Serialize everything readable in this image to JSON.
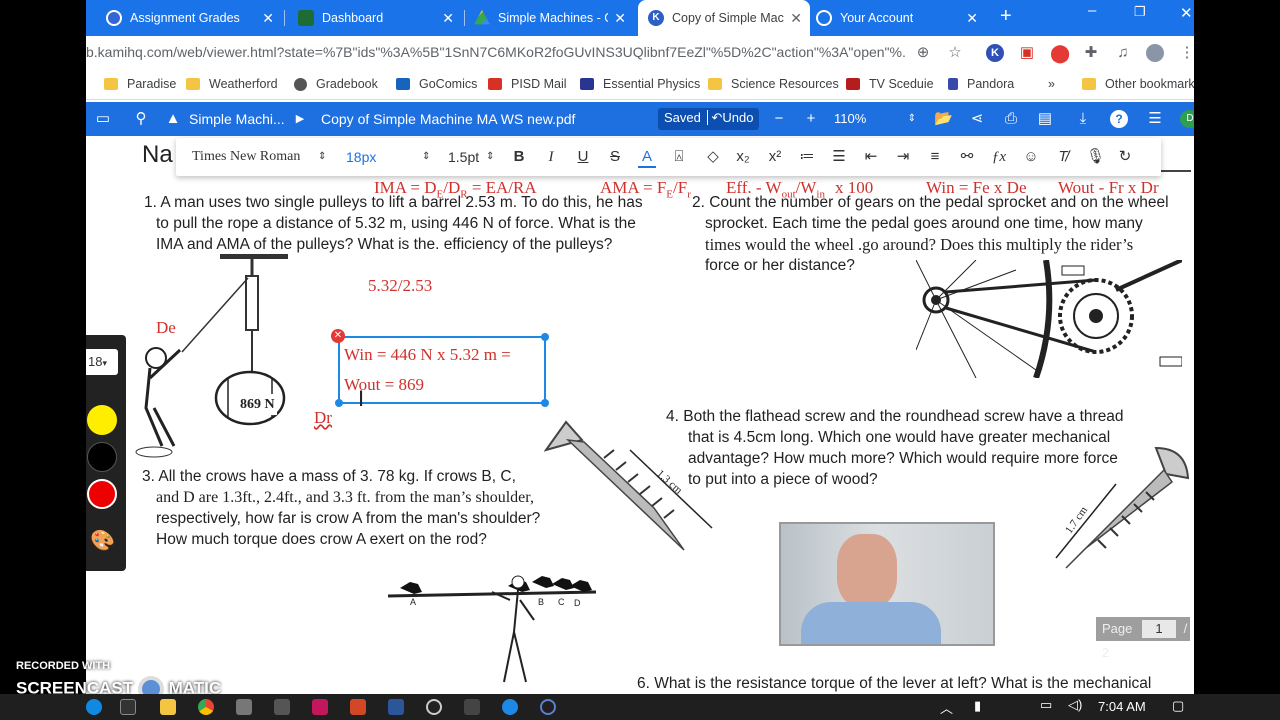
{
  "tabs": [
    {
      "title": "Assignment Grades",
      "active": false
    },
    {
      "title": "Dashboard",
      "active": false
    },
    {
      "title": "Simple Machines - G",
      "active": false
    },
    {
      "title": "Copy of Simple Mac",
      "active": true
    },
    {
      "title": "Your Account",
      "active": false
    }
  ],
  "address": {
    "url": "b.kamihq.com/web/viewer.html?state=%7B\"ids\"%3A%5B\"1SnN7C6MKoR2foGUvINS3UQlibnf7EeZl\"%5D%2C\"action\"%3A\"open\"%..."
  },
  "bookmarks": [
    "Paradise",
    "Weatherford",
    "Gradebook",
    "GoComics",
    "PISD Mail",
    "Essential Physics",
    "Science Resources",
    "TV Sceduie",
    "Pandora",
    "Other bookmarks"
  ],
  "kami": {
    "breadcrumb_folder": "Simple Machi...",
    "filename": "Copy of Simple Machine MA WS new.pdf",
    "saved": "Saved",
    "undo": "Undo",
    "zoom": "110%"
  },
  "format": {
    "font": "Times New Roman",
    "size": "18px",
    "line": "1.5pt"
  },
  "tool_panel": {
    "size": "18"
  },
  "doc": {
    "name_partial": "Na",
    "formula_line": {
      "ima": "IMA = D",
      "ima_sub": "E",
      "ima_mid": "/D",
      "ima_sub2": "R",
      "ima_end": " = EA/RA",
      "ama": "AMA = F",
      "ama_sub": "E",
      "ama_mid": "/F",
      "ama_sub2": "r",
      "eff": "Eff. - W",
      "eff_sub": "out",
      "eff_mid": "/W",
      "eff_sub2": "in",
      "eff_end": "x 100",
      "win": "Win = Fe x De",
      "wout": "Wout - Fr x Dr"
    },
    "q1": [
      "1. A man uses two single pulleys to lift a barrel 2.53 m. To do  this, he has",
      "to pull the rope a distance of 5.32 m, using  446 N of force. What is the",
      "IMA and AMA of the pulleys? What is the. efficiency of the pulleys?"
    ],
    "q2": [
      "2. Count the number of gears on the pedal sprocket and on the wheel",
      "sprocket. Each time the pedal goes around one time, how many",
      "times would the wheel .go around? Does this multiply the rider’s",
      "force or her distance?"
    ],
    "q3": [
      "3. All the crows have a mass of 3. 78 kg. If crows B, C,",
      "and D are 1.3ft., 2.4ft., and 3.3 ft. from the man’s shoulder,",
      "respectively, how far is crow A from the man's shoulder?",
      "How much torque does crow A exert on the rod?"
    ],
    "q4": [
      "4. Both the flathead screw and the roundhead screw have a thread",
      "that is 4.5cm long. Which one would have greater mechanical",
      "advantage? How much more? Which would require more force",
      "to put into a piece of wood?"
    ],
    "q6": "6. What is the resistance torque of the lever at left? What is the mechanical",
    "annot_ratio": "5.32/2.53",
    "annot_de": "De",
    "annot_dr": "Dr",
    "annot_win": "Win = 446 N x 5.32 m =",
    "annot_wout": "Wout = 869",
    "barrel_label": "869 N",
    "screw1_label": "1.3 cm",
    "screw2_label": "1.7 cm",
    "crow_labels": [
      "A",
      "B",
      "C",
      "D"
    ]
  },
  "page": {
    "label": "Page",
    "current": "1",
    "total": "/ 2"
  },
  "taskbar": {
    "time": "7:04 AM"
  },
  "watermark": {
    "line1": "RECORDED WITH",
    "line2a": "SCREENCAST",
    "line2b": "MATIC"
  },
  "colors": {
    "chrome_blue": "#1a73e8",
    "kami_blue": "#1e6fe0",
    "annot_red": "#d0312d"
  }
}
